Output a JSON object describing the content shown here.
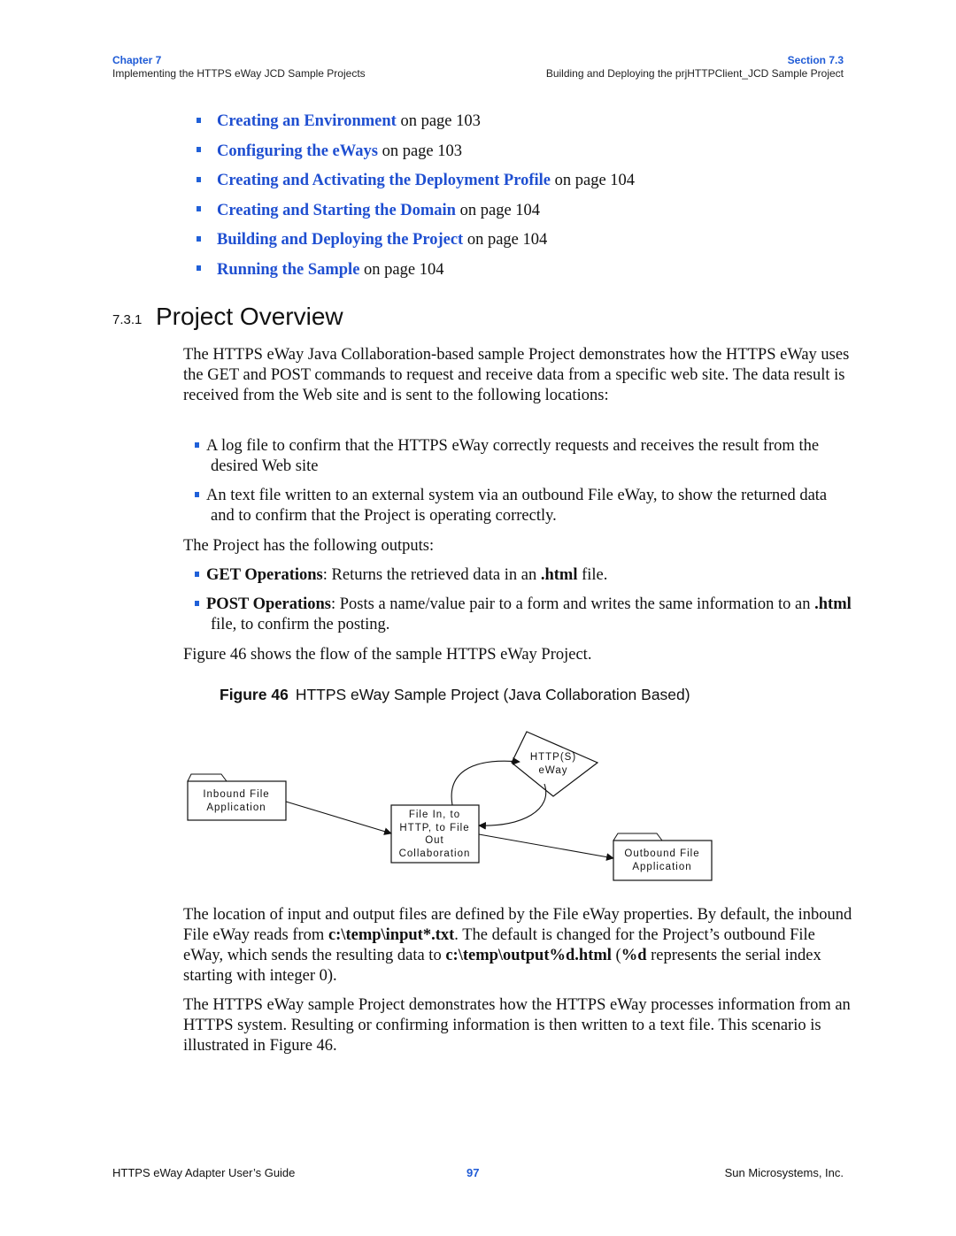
{
  "header": {
    "chapter": "Chapter 7",
    "chapter_title": "Implementing the HTTPS eWay JCD Sample Projects",
    "section": "Section 7.3",
    "section_title": "Building and Deploying the prjHTTPClient_JCD Sample Project"
  },
  "toc_links": [
    {
      "link": "Creating an Environment",
      "suffix": " on page 103"
    },
    {
      "link": "Configuring the eWays",
      "suffix": " on page 103"
    },
    {
      "link": "Creating and Activating the Deployment Profile",
      "suffix": " on page 104"
    },
    {
      "link": "Creating and Starting the Domain",
      "suffix": " on page 104"
    },
    {
      "link": "Building and Deploying the Project",
      "suffix": " on page 104"
    },
    {
      "link": "Running the Sample",
      "suffix": " on page 104"
    }
  ],
  "section": {
    "number": "7.3.1",
    "title": "Project Overview"
  },
  "intro_paragraph": "The HTTPS eWay Java Collaboration-based sample Project demonstrates how the HTTPS eWay uses the GET and POST commands to request and receive data from a specific web site. The data result is received from the Web site and is sent to the following locations:",
  "locations": [
    "A log file to confirm that the HTTPS eWay correctly requests and receives the result from the desired Web site",
    "An text file written to an external system via an outbound File eWay, to show the returned data and to confirm that the Project is operating correctly."
  ],
  "outputs_intro": "The Project has the following outputs:",
  "outputs": [
    {
      "term": "GET Operations",
      "text_a": ": Returns the retrieved data in an ",
      "code": ".html",
      "text_b": " file."
    },
    {
      "term": "POST Operations",
      "text_a": ": Posts a name/value pair to a form and writes the same information to an ",
      "code": ".html",
      "text_b": " file, to confirm the posting."
    }
  ],
  "figure_ref": "Figure 46 shows the flow of the sample HTTPS eWay Project.",
  "figure": {
    "label": "Figure 46",
    "caption": "HTTPS eWay Sample Project (Java Collaboration Based)",
    "nodes": {
      "inbound": [
        "Inbound File",
        "Application"
      ],
      "collab": [
        "File In, to",
        "HTTP, to File",
        "Out",
        "Collaboration"
      ],
      "eway": [
        "HTTP(S)",
        "eWay"
      ],
      "outbound": [
        "Outbound File",
        "Application"
      ]
    }
  },
  "location_paragraph": {
    "t1": "The location of input and output files are defined by the File eWay properties. By default, the inbound File eWay reads from ",
    "b1": "c:\\temp\\input*.txt",
    "t2": ". The default is changed for the Project’s outbound File eWay, which sends the resulting data to ",
    "b2": "c:\\temp\\output%d.html",
    "t3": " (",
    "b3": "%d",
    "t4": " represents the serial index starting with integer 0)."
  },
  "closing_paragraph": "The HTTPS eWay sample Project demonstrates how the HTTPS eWay processes information from an HTTPS system. Resulting or confirming information is then written to a text file. This scenario is illustrated in Figure 46.",
  "footer": {
    "left": "HTTPS eWay Adapter User’s Guide",
    "page": "97",
    "right": "Sun Microsystems, Inc."
  },
  "colors": {
    "link": "#1f4fd1",
    "header_accent": "#1f5bd6"
  }
}
